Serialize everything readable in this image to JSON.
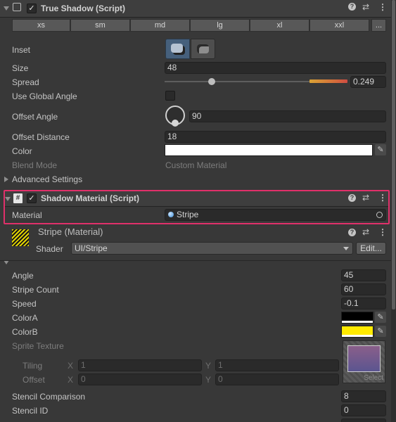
{
  "true_shadow": {
    "title": "True Shadow (Script)",
    "enabled": true,
    "size_presets": [
      "xs",
      "sm",
      "md",
      "lg",
      "xl",
      "xxl",
      "..."
    ],
    "inset_label": "Inset",
    "size": {
      "label": "Size",
      "value": "48"
    },
    "spread": {
      "label": "Spread",
      "value": "0.249",
      "slider_fraction": 0.249
    },
    "use_global_angle": {
      "label": "Use Global Angle",
      "checked": false
    },
    "offset_angle": {
      "label": "Offset Angle",
      "value": "90"
    },
    "offset_distance": {
      "label": "Offset Distance",
      "value": "18"
    },
    "color": {
      "label": "Color",
      "value": "#ffffff"
    },
    "blend_mode": {
      "label": "Blend Mode",
      "value": "Custom Material"
    },
    "advanced_settings": "Advanced Settings"
  },
  "shadow_material": {
    "title": "Shadow Material (Script)",
    "enabled": true,
    "material": {
      "label": "Material",
      "value": "Stripe"
    },
    "highlight_color": "#e0306a"
  },
  "stripe_material": {
    "title": "Stripe (Material)",
    "shader_label": "Shader",
    "shader_value": "UI/Stripe",
    "edit_button": "Edit..."
  },
  "props": {
    "angle": {
      "label": "Angle",
      "value": "45"
    },
    "stripe_count": {
      "label": "Stripe Count",
      "value": "60"
    },
    "speed": {
      "label": "Speed",
      "value": "-0.1"
    },
    "colorA": {
      "label": "ColorA",
      "value": "#000000"
    },
    "colorB": {
      "label": "ColorB",
      "value": "#ffea00"
    },
    "sprite_texture": {
      "label": "Sprite Texture",
      "select": "Select"
    },
    "tiling": {
      "label": "Tiling",
      "x_label": "X",
      "x": "1",
      "y_label": "Y",
      "y": "1"
    },
    "offset": {
      "label": "Offset",
      "x_label": "X",
      "x": "0",
      "y_label": "Y",
      "y": "0"
    },
    "stencil_comparison": {
      "label": "Stencil Comparison",
      "value": "8"
    },
    "stencil_id": {
      "label": "Stencil ID",
      "value": "0"
    }
  }
}
